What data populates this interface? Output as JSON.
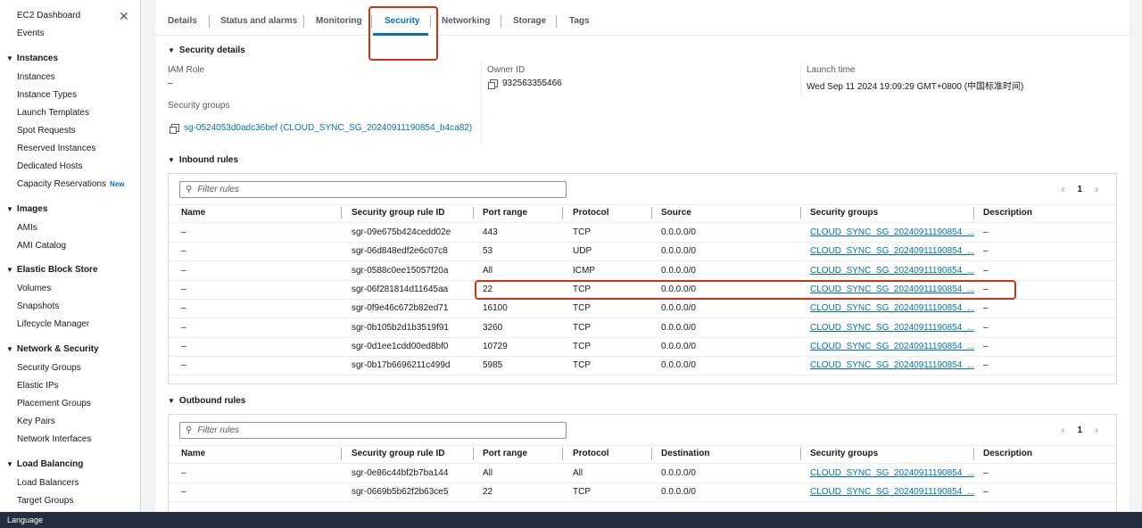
{
  "sidebar": {
    "top_link": "EC2 Dashboard",
    "events": "Events",
    "close_icon": "close-icon",
    "sections": [
      {
        "title": "Instances",
        "items": [
          "Instances",
          "Instance Types",
          "Launch Templates",
          "Spot Requests",
          "Reserved Instances",
          "Dedicated Hosts",
          "Capacity Reservations"
        ]
      },
      {
        "title": "Images",
        "items": [
          "AMIs",
          "AMI Catalog"
        ]
      },
      {
        "title": "Elastic Block Store",
        "items": [
          "Volumes",
          "Snapshots",
          "Lifecycle Manager"
        ]
      },
      {
        "title": "Network & Security",
        "items": [
          "Security Groups",
          "Elastic IPs",
          "Placement Groups",
          "Key Pairs",
          "Network Interfaces"
        ]
      },
      {
        "title": "Load Balancing",
        "items": [
          "Load Balancers",
          "Target Groups"
        ]
      }
    ],
    "new_badge": "New"
  },
  "tabs": [
    "Details",
    "Status and alarms",
    "Monitoring",
    "Security",
    "Networking",
    "Storage",
    "Tags"
  ],
  "security_details": {
    "heading": "Security details",
    "iam_role_label": "IAM Role",
    "iam_role_value": "–",
    "owner_id_label": "Owner ID",
    "owner_id_value": "932563355466",
    "launch_time_label": "Launch time",
    "launch_time_value": "Wed Sep 11 2024 19:09:29 GMT+0800 (中国标准时间)",
    "security_groups_label": "Security groups",
    "security_groups_value": "sg-0524053d0adc36bef (CLOUD_SYNC_SG_20240911190854_b4ca82)"
  },
  "inbound": {
    "heading": "Inbound rules",
    "filter_placeholder": "Filter rules",
    "page": "1",
    "columns": [
      "Name",
      "Security group rule ID",
      "Port range",
      "Protocol",
      "Source",
      "Security groups",
      "Description"
    ],
    "rows": [
      [
        "–",
        "sgr-09e675b424cedd02e",
        "443",
        "TCP",
        "0.0.0.0/0",
        "CLOUD_SYNC_SG_20240911190854_...",
        "–"
      ],
      [
        "–",
        "sgr-06d848edf2e6c07c8",
        "53",
        "UDP",
        "0.0.0.0/0",
        "CLOUD_SYNC_SG_20240911190854_...",
        "–"
      ],
      [
        "–",
        "sgr-0588c0ee15057f20a",
        "All",
        "ICMP",
        "0.0.0.0/0",
        "CLOUD_SYNC_SG_20240911190854_...",
        "–"
      ],
      [
        "–",
        "sgr-06f281814d11645aa",
        "22",
        "TCP",
        "0.0.0.0/0",
        "CLOUD_SYNC_SG_20240911190854_...",
        "–"
      ],
      [
        "–",
        "sgr-0f9e46c672b82ed71",
        "16100",
        "TCP",
        "0.0.0.0/0",
        "CLOUD_SYNC_SG_20240911190854_...",
        "–"
      ],
      [
        "–",
        "sgr-0b105b2d1b3519f91",
        "3260",
        "TCP",
        "0.0.0.0/0",
        "CLOUD_SYNC_SG_20240911190854_...",
        "–"
      ],
      [
        "–",
        "sgr-0d1ee1cdd00ed8bf0",
        "10729",
        "TCP",
        "0.0.0.0/0",
        "CLOUD_SYNC_SG_20240911190854_...",
        "–"
      ],
      [
        "–",
        "sgr-0b17b6696211c499d",
        "5985",
        "TCP",
        "0.0.0.0/0",
        "CLOUD_SYNC_SG_20240911190854_...",
        "–"
      ]
    ]
  },
  "outbound": {
    "heading": "Outbound rules",
    "filter_placeholder": "Filter rules",
    "page": "1",
    "columns": [
      "Name",
      "Security group rule ID",
      "Port range",
      "Protocol",
      "Destination",
      "Security groups",
      "Description"
    ],
    "rows": [
      [
        "–",
        "sgr-0e86c44bf2b7ba144",
        "All",
        "All",
        "0.0.0.0/0",
        "CLOUD_SYNC_SG_20240911190854_...",
        "–"
      ],
      [
        "–",
        "sgr-0669b5b62f2b63ce5",
        "22",
        "TCP",
        "0.0.0.0/0",
        "CLOUD_SYNC_SG_20240911190854_...",
        "–"
      ]
    ]
  },
  "footer": {
    "language": "Language"
  },
  "colors": {
    "accent": "#0073bb",
    "highlight": "#d13212",
    "footer_bg": "#232f3e"
  }
}
